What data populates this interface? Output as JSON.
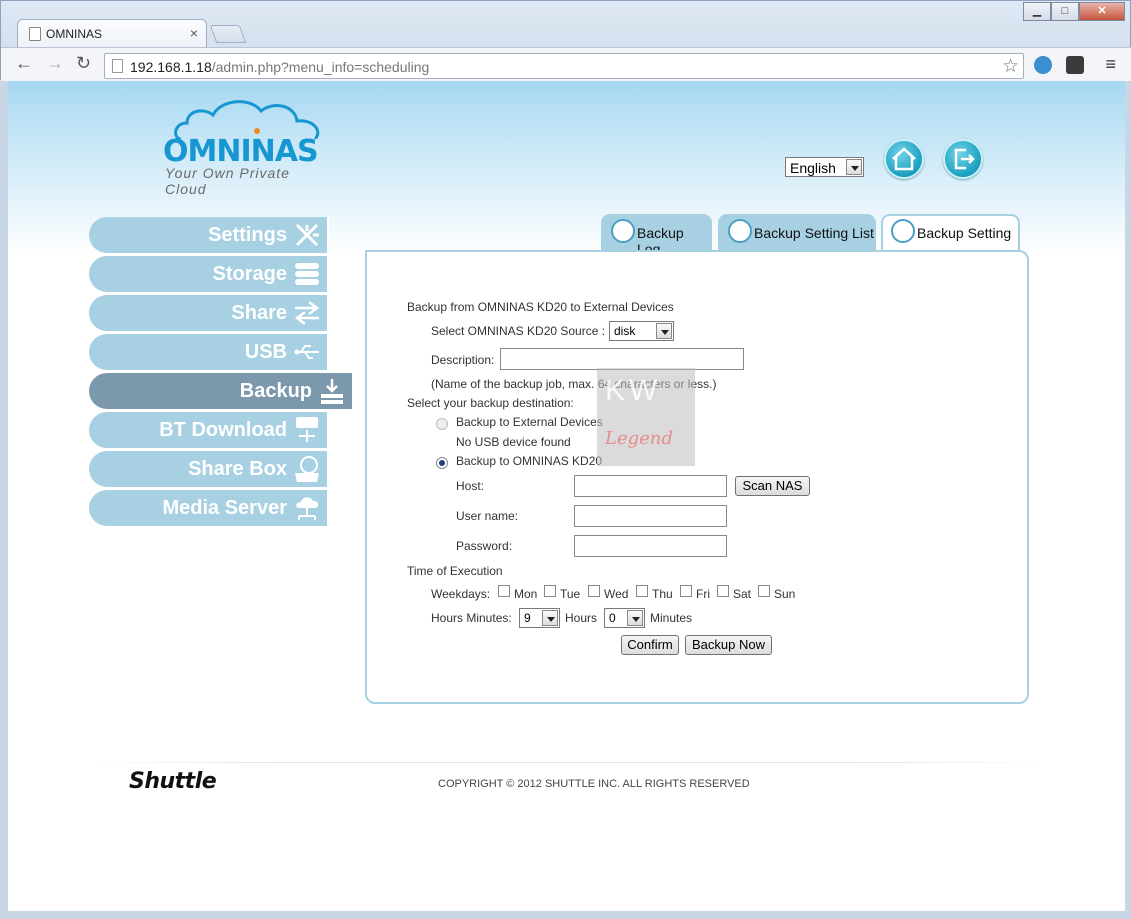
{
  "browser": {
    "tab_title": "OMNINAS",
    "url_host": "192.168.1.18",
    "url_path": "/admin.php?menu_info=scheduling"
  },
  "header": {
    "logo_brand": "OMNINAS",
    "logo_tagline": "Your Own Private Cloud",
    "language": "English"
  },
  "sidebar": {
    "items": [
      {
        "label": "Settings"
      },
      {
        "label": "Storage"
      },
      {
        "label": "Share"
      },
      {
        "label": "USB"
      },
      {
        "label": "Backup"
      },
      {
        "label": "BT Download"
      },
      {
        "label": "Share Box"
      },
      {
        "label": "Media Server"
      }
    ]
  },
  "tabs": [
    {
      "label": "Backup Log"
    },
    {
      "label": "Backup Setting List"
    },
    {
      "label": "Backup Setting"
    }
  ],
  "form": {
    "section_title": "Backup from OMNINAS KD20 to External Devices",
    "source_label": "Select OMNINAS KD20 Source :",
    "source_value": "disk",
    "description_label": "Description:",
    "description_value": "",
    "description_hint": "(Name of the backup job, max. 64 characters or less.)",
    "destination_label": "Select your backup destination:",
    "dest_external": "Backup to External Devices",
    "no_usb": "No USB device found",
    "dest_nas": "Backup to OMNINAS KD20",
    "host_label": "Host:",
    "host_value": "",
    "scan_button": "Scan NAS",
    "username_label": "User name:",
    "username_value": "",
    "password_label": "Password:",
    "password_value": "",
    "time_title": "Time of Execution",
    "weekdays_label": "Weekdays:",
    "days": [
      "Mon",
      "Tue",
      "Wed",
      "Thu",
      "Fri",
      "Sat",
      "Sun"
    ],
    "hours_minutes_label": "Hours Minutes:",
    "hours_value": "9",
    "hours_unit": "Hours",
    "minutes_value": "0",
    "minutes_unit": "Minutes",
    "confirm_button": "Confirm",
    "backup_now_button": "Backup Now"
  },
  "watermark": {
    "line1": "KW",
    "line2": "Legend"
  },
  "footer": {
    "brand": "Shuttle",
    "copyright": "COPYRIGHT © 2012 SHUTTLE INC. ALL RIGHTS RESERVED"
  },
  "colors": {
    "nav": "#a7d0e3",
    "nav_active": "#7b98ac",
    "brand": "#1797d2"
  }
}
